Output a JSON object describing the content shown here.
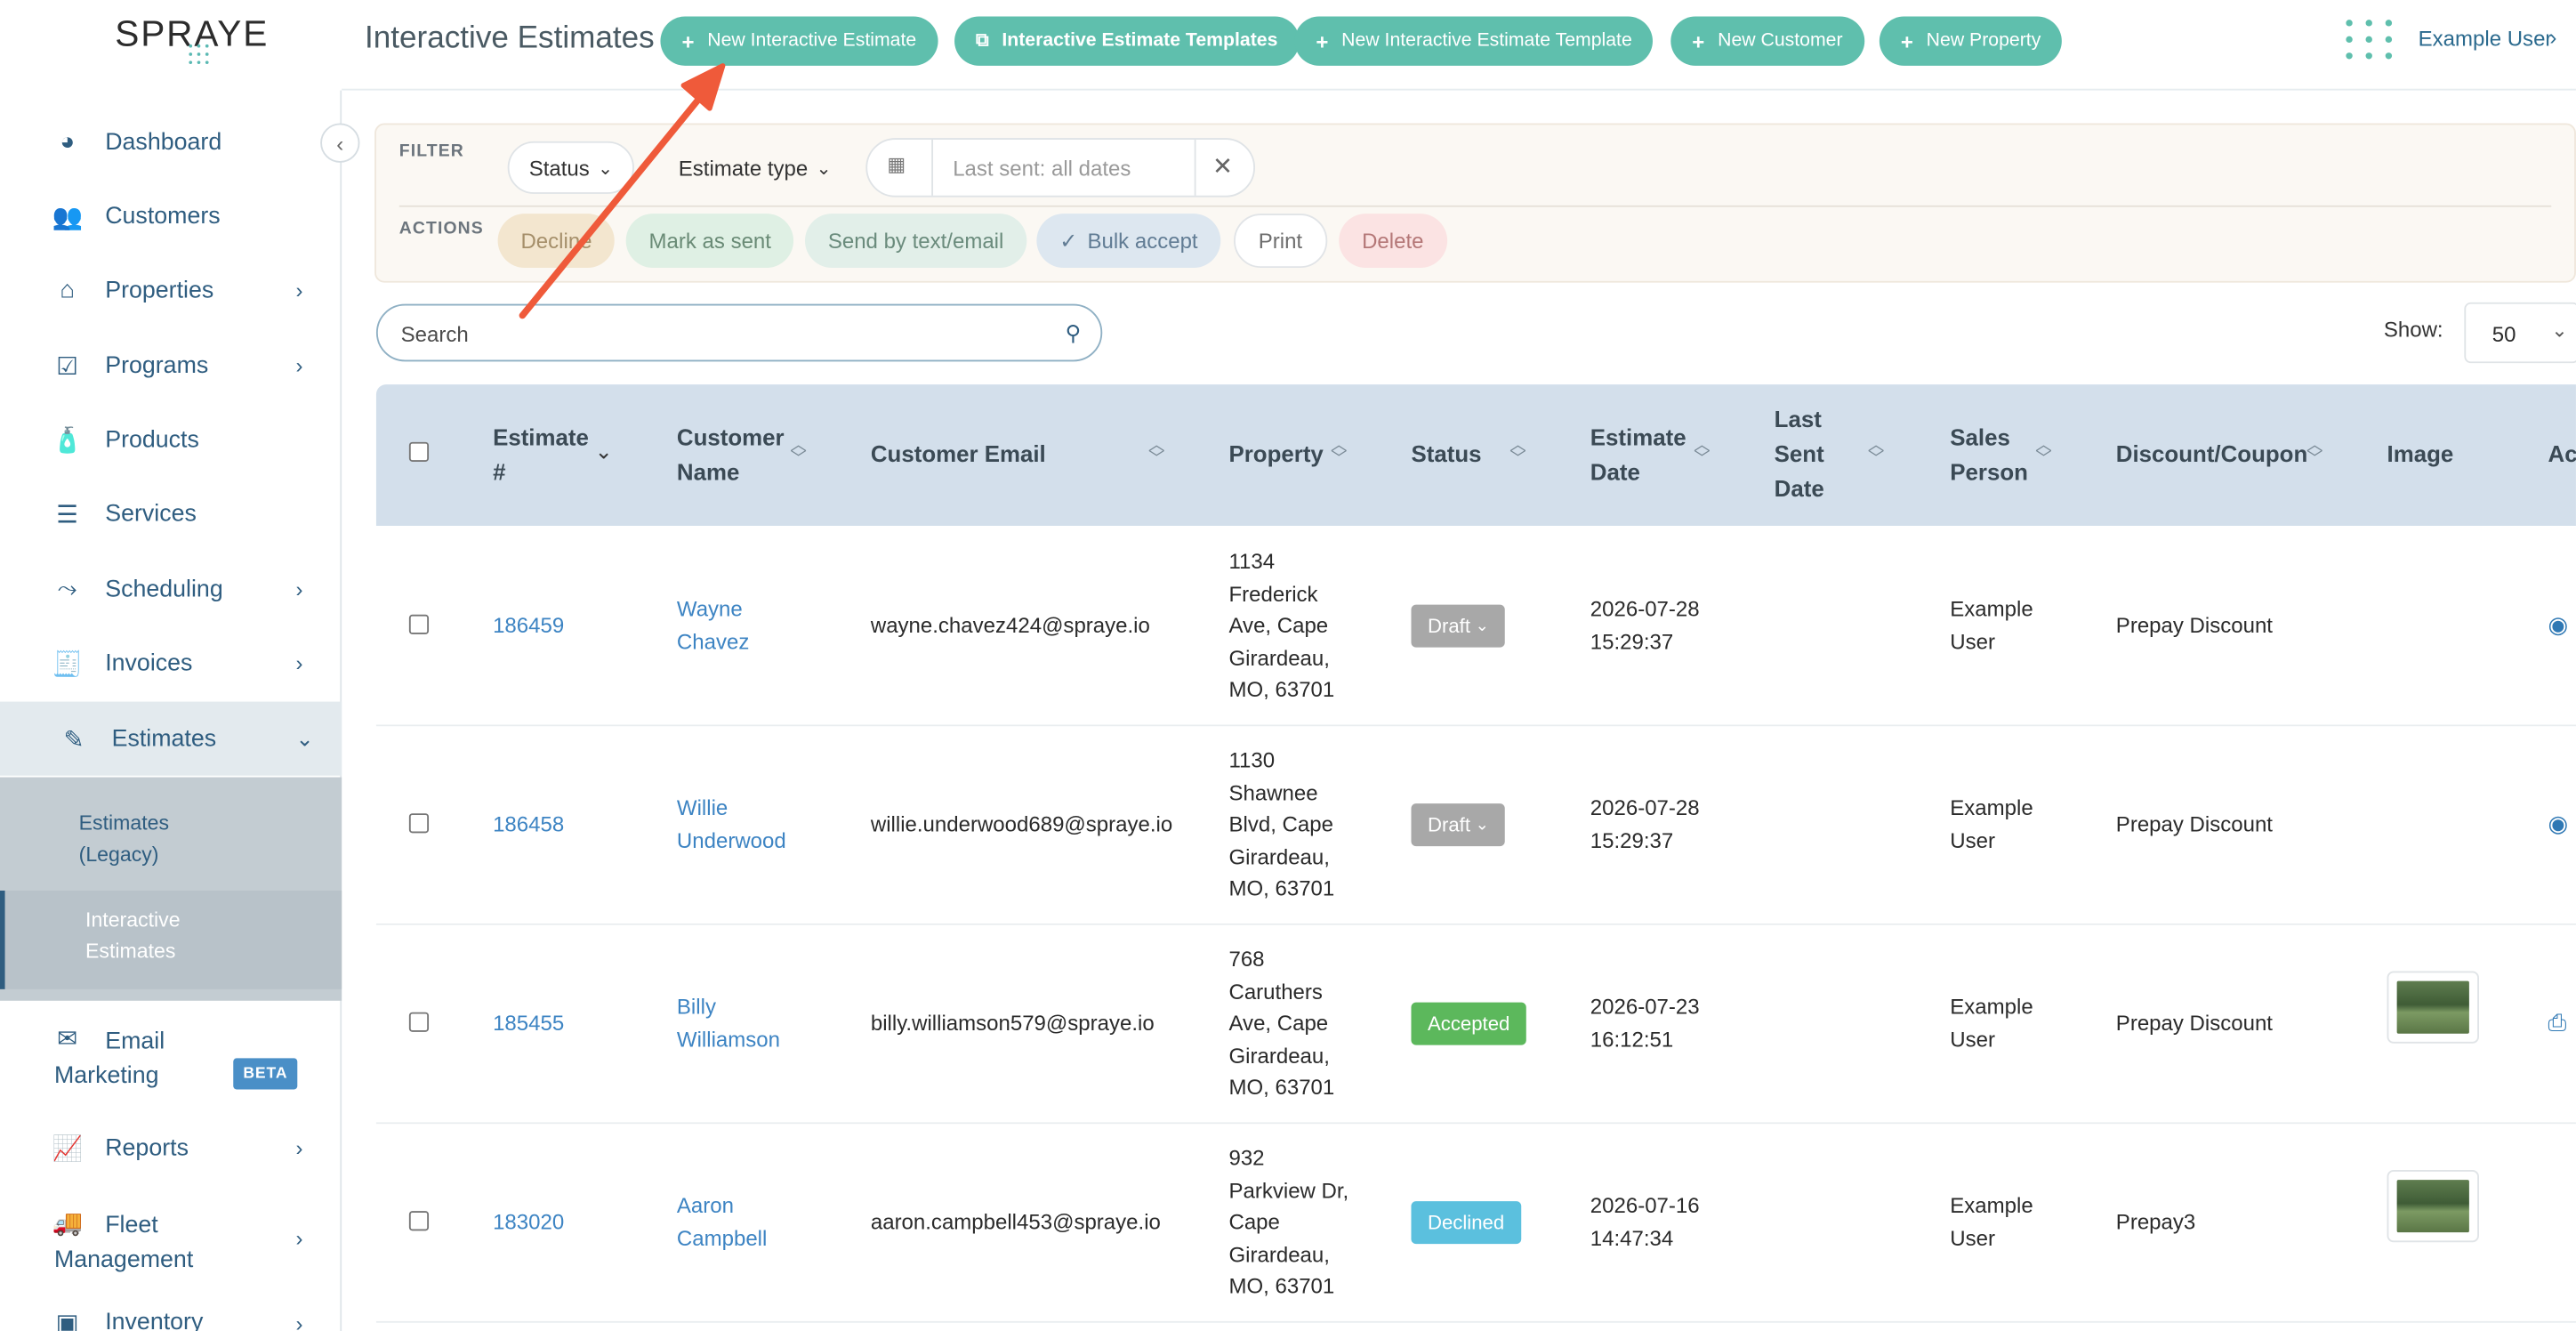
{
  "brand": {
    "logo_text": "SPRAYE"
  },
  "header": {
    "title": "Interactive Estimates",
    "buttons": [
      {
        "label": "New Interactive Estimate",
        "icon": "plus-icon"
      },
      {
        "label": "Interactive Estimate Templates",
        "icon": "copy-icon"
      },
      {
        "label": "New Interactive Estimate Template",
        "icon": "plus-icon"
      },
      {
        "label": "New Customer",
        "icon": "plus-icon"
      },
      {
        "label": "New Property",
        "icon": "plus-icon"
      }
    ],
    "user": "Example User",
    "accent": "#5fbfad"
  },
  "sidebar": {
    "items": [
      {
        "label": "Dashboard",
        "icon": "dashboard-icon"
      },
      {
        "label": "Customers",
        "icon": "users-icon"
      },
      {
        "label": "Properties",
        "icon": "home-icon"
      },
      {
        "label": "Programs",
        "icon": "calendar-check-icon"
      },
      {
        "label": "Products",
        "icon": "bottle-icon"
      },
      {
        "label": "Services",
        "icon": "list-icon"
      },
      {
        "label": "Scheduling",
        "icon": "route-icon"
      },
      {
        "label": "Invoices",
        "icon": "invoice-icon"
      },
      {
        "label": "Estimates",
        "icon": "estimate-icon"
      },
      {
        "label": "Email",
        "label2": "Marketing",
        "icon": "mail-icon",
        "badge": "BETA"
      },
      {
        "label": "Reports",
        "icon": "chart-icon"
      },
      {
        "label": "Fleet",
        "label2": "Management",
        "icon": "truck-icon"
      },
      {
        "label": "Inventory",
        "icon": "box-icon"
      }
    ],
    "estimates_sub": [
      {
        "line1": "Estimates",
        "line2": "(Legacy)"
      },
      {
        "line1": "Interactive",
        "line2": "Estimates"
      }
    ]
  },
  "filter": {
    "filter_label": "FILTER",
    "actions_label": "ACTIONS",
    "status": "Status",
    "estimate_type": "Estimate type",
    "date_placeholder": "Last sent: all dates",
    "actions": [
      "Decline",
      "Mark as sent",
      "Send by text/email",
      "Bulk accept",
      "Print",
      "Delete"
    ]
  },
  "search": {
    "placeholder": "Search"
  },
  "show": {
    "label": "Show:",
    "value": "50"
  },
  "table": {
    "columns": [
      {
        "l1": "Estimate",
        "l2": "#"
      },
      {
        "l1": "Customer",
        "l2": "Name"
      },
      {
        "l1": "Customer Email"
      },
      {
        "l1": "Property"
      },
      {
        "l1": "Status"
      },
      {
        "l1": "Estimate",
        "l2": "Date"
      },
      {
        "l1": "Last",
        "l2": "Sent",
        "l3": "Date"
      },
      {
        "l1": "Sales",
        "l2": "Person"
      },
      {
        "l1": "Discount/Coupon"
      },
      {
        "l1": "Image"
      },
      {
        "l1": "Ac"
      }
    ],
    "rows": [
      {
        "id": "186459",
        "name1": "Wayne",
        "name2": "Chavez",
        "email": "wayne.chavez424@spraye.io",
        "prop": [
          "1134",
          "Frederick",
          "Ave, Cape",
          "Girardeau,",
          "MO, 63701"
        ],
        "status": "Draft",
        "date1": "2026-07-28",
        "date2": "15:29:37",
        "sp1": "Example",
        "sp2": "User",
        "discount": "Prepay Discount",
        "image": false,
        "action": "eye-icon"
      },
      {
        "id": "186458",
        "name1": "Willie",
        "name2": "Underwood",
        "email": "willie.underwood689@spraye.io",
        "prop": [
          "1130",
          "Shawnee",
          "Blvd, Cape",
          "Girardeau,",
          "MO, 63701"
        ],
        "status": "Draft",
        "date1": "2026-07-28",
        "date2": "15:29:37",
        "sp1": "Example",
        "sp2": "User",
        "discount": "Prepay Discount",
        "image": false,
        "action": "eye-icon"
      },
      {
        "id": "185455",
        "name1": "Billy",
        "name2": "Williamson",
        "email": "billy.williamson579@spraye.io",
        "prop": [
          "768",
          "Caruthers",
          "Ave, Cape",
          "Girardeau,",
          "MO, 63701"
        ],
        "status": "Accepted",
        "date1": "2026-07-23",
        "date2": "16:12:51",
        "sp1": "Example",
        "sp2": "User",
        "discount": "Prepay Discount",
        "image": true,
        "action": "print-icon"
      },
      {
        "id": "183020",
        "name1": "Aaron",
        "name2": "Campbell",
        "email": "aaron.campbell453@spraye.io",
        "prop": [
          "932",
          "Parkview Dr,",
          "Cape",
          "Girardeau,",
          "MO, 63701"
        ],
        "status": "Declined",
        "date1": "2026-07-16",
        "date2": "14:47:34",
        "sp1": "Example",
        "sp2": "User",
        "discount": "Prepay3",
        "image": true,
        "action": ""
      }
    ]
  },
  "status_colors": {
    "Draft": "#a8a8a8",
    "Accepted": "#5cb85c",
    "Declined": "#5bc0de"
  }
}
